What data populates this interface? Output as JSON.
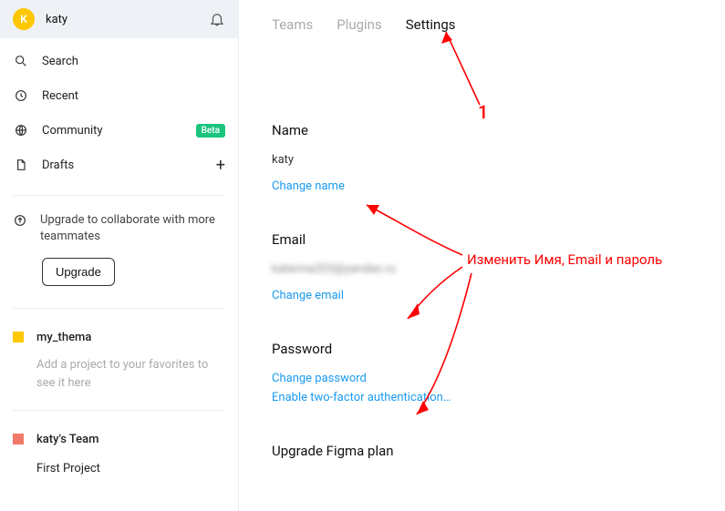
{
  "user": {
    "initial": "K",
    "name": "katy"
  },
  "nav": {
    "search": "Search",
    "recent": "Recent",
    "community": "Community",
    "community_badge": "Beta",
    "drafts": "Drafts"
  },
  "upgrade": {
    "text": "Upgrade to collaborate with more teammates",
    "button": "Upgrade"
  },
  "teams": {
    "my_thema": {
      "name": "my_thema",
      "fav_hint": "Add a project to your favorites to see it here"
    },
    "katys_team": {
      "name": "katy's Team",
      "project": "First Project"
    }
  },
  "tabs": {
    "teams": "Teams",
    "plugins": "Plugins",
    "settings": "Settings"
  },
  "settings": {
    "name_title": "Name",
    "name_value": "katy",
    "change_name": "Change name",
    "email_title": "Email",
    "email_value": "katerina203@yandex.ru",
    "change_email": "Change email",
    "password_title": "Password",
    "change_password": "Change password",
    "enable_2fa": "Enable two-factor authentication…",
    "upgrade_plan_title": "Upgrade Figma plan"
  },
  "annotations": {
    "num1": "1",
    "text": "Изменить Имя, Email и пароль"
  }
}
